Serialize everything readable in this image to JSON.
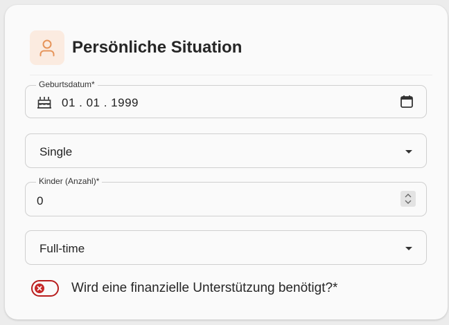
{
  "section": {
    "title": "Persönliche Situation",
    "icon": "user-icon",
    "accent": "#e6945a"
  },
  "birthdate": {
    "label": "Geburtsdatum*",
    "value": "01 . 01 . 1999",
    "leading_icon": "cake-icon",
    "trailing_icon": "calendar-icon"
  },
  "marital_status": {
    "value": "Single",
    "icon": "chevron-down-icon"
  },
  "children": {
    "label": "Kinder (Anzahl)*",
    "value": "0",
    "icon": "stepper-icon"
  },
  "employment": {
    "value": "Full-time",
    "icon": "chevron-down-icon"
  },
  "support_toggle": {
    "label": "Wird eine finanzielle Unterstützung benötigt?*",
    "checked": false,
    "color": "#c62828"
  }
}
